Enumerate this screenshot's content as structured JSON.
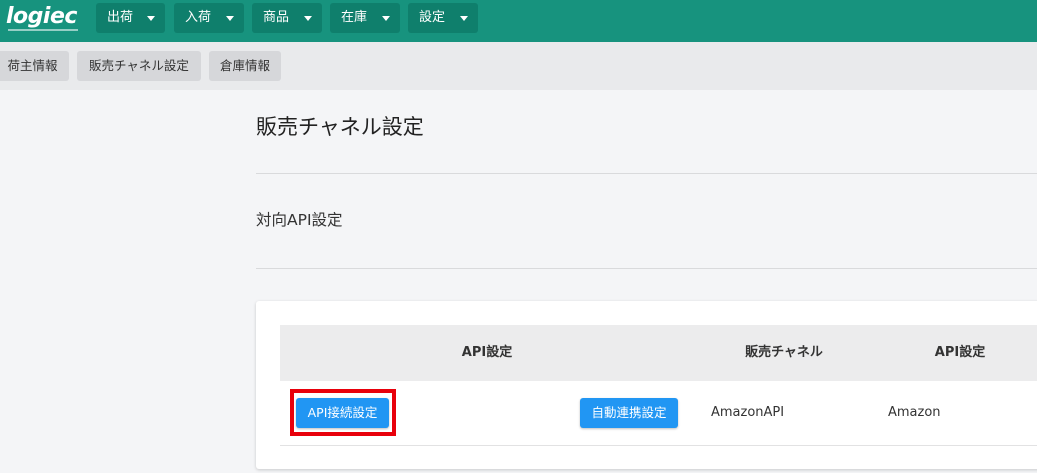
{
  "app": {
    "logo_text": "logiec"
  },
  "topnav": {
    "items": [
      {
        "label": "出荷"
      },
      {
        "label": "入荷"
      },
      {
        "label": "商品"
      },
      {
        "label": "在庫"
      },
      {
        "label": "設定"
      }
    ]
  },
  "subnav": {
    "items": [
      {
        "label": "荷主情報"
      },
      {
        "label": "販売チャネル設定"
      },
      {
        "label": "倉庫情報"
      }
    ]
  },
  "page": {
    "title": "販売チャネル設定",
    "section_title": "対向API設定"
  },
  "table": {
    "headers": [
      "API設定",
      "販売チャネル",
      "API設定"
    ],
    "rows": [
      {
        "api_connect_label": "API接続設定",
        "auto_link_label": "自動連携設定",
        "channel": "AmazonAPI",
        "api": "Amazon"
      }
    ]
  },
  "colors": {
    "topbar": "#17937e",
    "menu_button": "#0f7f6c",
    "primary_button": "#2196f3",
    "highlight": "#e8000b"
  }
}
